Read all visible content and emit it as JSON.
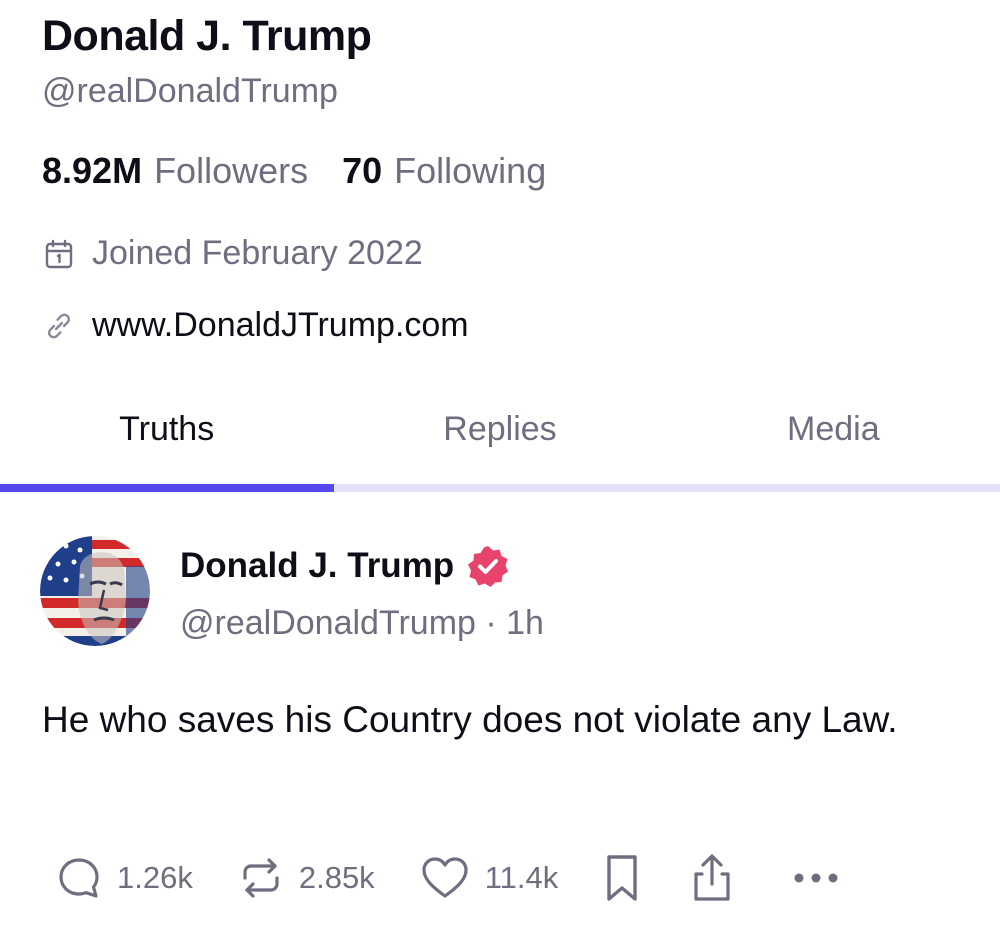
{
  "profile": {
    "name": "Donald J. Trump",
    "handle": "@realDonaldTrump",
    "followers_count": "8.92M",
    "followers_label": "Followers",
    "following_count": "70",
    "following_label": "Following",
    "joined": "Joined February 2022",
    "website": "www.DonaldJTrump.com"
  },
  "tabs": [
    {
      "label": "Truths",
      "active": true
    },
    {
      "label": "Replies",
      "active": false
    },
    {
      "label": "Media",
      "active": false
    }
  ],
  "post": {
    "author_name": "Donald J. Trump",
    "author_meta": "@realDonaldTrump · 1h",
    "body": "He who saves his Country does not violate any Law.",
    "replies": "1.26k",
    "retruths": "2.85k",
    "likes": "11.4k"
  },
  "icons": {
    "calendar": "calendar-icon",
    "link": "link-icon",
    "verified": "verified-badge-icon",
    "reply": "reply-icon",
    "retruth": "retruth-icon",
    "like": "heart-icon",
    "bookmark": "bookmark-icon",
    "share": "share-icon",
    "more": "more-icon"
  },
  "colors": {
    "accent": "#5448ee",
    "verified": "#e8436a",
    "muted_text": "#6e6e80"
  }
}
